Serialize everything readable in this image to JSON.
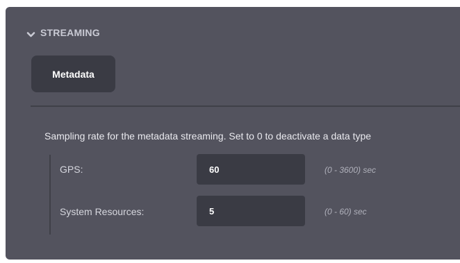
{
  "section": {
    "title": "STREAMING",
    "expanded_icon": "chevron-down-icon"
  },
  "tabs": [
    {
      "label": "Metadata",
      "active": true
    }
  ],
  "description": "Sampling rate for the metadata streaming. Set to 0 to deactivate a data type",
  "fields": [
    {
      "label": "GPS:",
      "value": "60",
      "range": "(0 - 3600) sec"
    },
    {
      "label": "System Resources:",
      "value": "5",
      "range": "(0 - 60) sec"
    }
  ],
  "colors": {
    "panel_bg": "#53535e",
    "input_bg": "#3a3b44",
    "text": "#e9e9ee",
    "muted": "#b0b1bb"
  }
}
